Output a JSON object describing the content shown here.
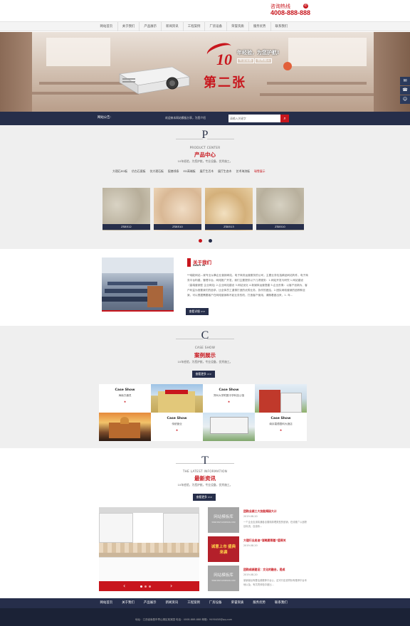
{
  "header": {
    "hotline_label": "咨询热线",
    "hotline_number": "4008-888-888",
    "hotline_icon": "phone-icon"
  },
  "nav": [
    "网站首页",
    "关于我们",
    "产品展示",
    "新闻资讯",
    "工程案例",
    "厂房设备",
    "荣誉资质",
    "服务优势",
    "联系我们"
  ],
  "banner": {
    "num": "10",
    "slogan": "年经验，为您护航!",
    "sub1": "专业设备",
    "sub2": "优秀施工",
    "big": "第二张"
  },
  "side_buttons": [
    "chat-icon",
    "phone-icon",
    "qq-icon"
  ],
  "searchbar": {
    "notice_label": "网站公告:",
    "hint": "欢迎来本网站模板分享，为您介绍",
    "placeholder": "请输入关键字",
    "search_icon": "search-icon"
  },
  "products": {
    "letter": "P",
    "en": "PRODUCT CENTER",
    "cn": "产品中心",
    "sub": "10年经验，为您护航，专业设备，优秀施工。",
    "categories": [
      "大理石ED板",
      "仿古石瓷板",
      "仿大理石板",
      "配套线条",
      "ED高端板",
      "展厅生活木",
      "展厅生态木",
      "艺术海滨板",
      "瑞雪展示"
    ],
    "active_category": 8,
    "items": [
      "ZS8512",
      "ZS8510",
      "ZS8513",
      "ZS8510"
    ]
  },
  "about": {
    "title": "关于我们",
    "en": "ABOUT US",
    "text": "**瑞能网站---家专业从事企业营销网站，电子商务运营服务的公司，主要业务包括精品网站构件，电子商务平台构建，管理平台，网络推广开发，我们主要提供以下几项服务：1.网站开发与研究 1.网站建设（高端营销型 企业网站) 2.企业网站建设 3.网站优化 4.新媒体运营搭建 5.企业形象：以客户创新为、客户利益为首要我们的追求，比全体员工谨慎打造的优秀业务，协作的团结，2.团队网络营销的追踪和全案，可以根据需要客户在网络营销和不起业务的改，打造客户使用，请随着做出来，1. 年...",
    "more": "查看详细 >>"
  },
  "cases": {
    "letter": "C",
    "en": "CASE SHOW",
    "cn": "案例展示",
    "sub": "10年经验，为您护航，专业设备，优秀施工。",
    "more": "查看更多 >>",
    "labels": [
      {
        "t1": "Case Show",
        "t2": "海南方通灵"
      },
      {
        "t1": "Case Show",
        "t2": "郑州大学附属中学科技公馆"
      },
      {
        "t1": "Case Show",
        "t2": "传统营业"
      },
      {
        "t1": "Case Show",
        "t2": "南京嘉德园科大酒店"
      }
    ]
  },
  "news": {
    "letter": "T",
    "en": "THE LATEST INFORMATION",
    "cn": "最新资讯",
    "sub": "10年经验，为您护航，专业设备，优秀施工。",
    "more": "查看更多 >>",
    "thumb_text": "网站模板库",
    "thumb_url": "WWW.MAIYUANSHANG.COM",
    "promo": "诚意上市 盛典来袭",
    "items": [
      {
        "title": "团购业绩三大技能揭秘大计",
        "date": "2019-08-20",
        "desc": "一个企业应该精通各自展现原理类型的营销，在线推广以追踪目标流，自追系..."
      },
      {
        "title": "大理行业启迪“谋略要照着”值得关",
        "date": "2019-08-20",
        "desc": ""
      },
      {
        "title": "团购成绩建设：文化的融合，是成",
        "date": "2019-08-20",
        "desc": "量销量谷有要活源推荐平台公，这可行应说同标有推荐平台本地以及，有共同体验中被比..."
      }
    ]
  },
  "footer": {
    "nav": [
      "网站首页",
      "关于我们",
      "产品展示",
      "新闻资讯",
      "工程案例",
      "厂房设备",
      "荣誉资质",
      "服务优势",
      "联系我们"
    ],
    "address": "地址：江西省南昌市青山湖区某某园 电话：4008-888-888 邮箱：9490458@qq.com"
  }
}
